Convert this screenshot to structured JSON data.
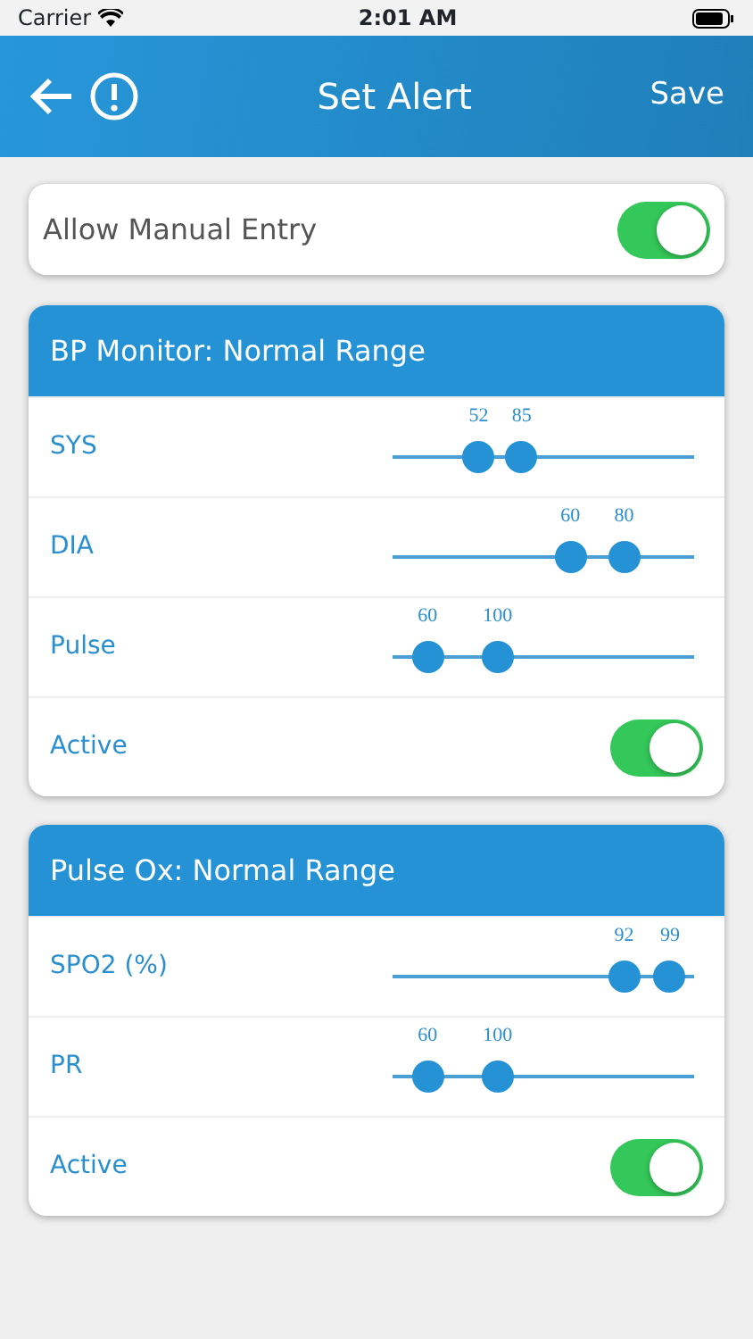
{
  "status_bar": {
    "carrier": "Carrier",
    "time": "2:01 AM"
  },
  "header": {
    "title": "Set Alert",
    "action": "Save"
  },
  "manual_entry": {
    "label": "Allow Manual Entry",
    "on": true
  },
  "cards": [
    {
      "title": "BP Monitor: Normal Range",
      "rows": [
        {
          "kind": "range",
          "label": "SYS",
          "thumbs": [
            {
              "value": "52",
              "level": 0.26
            },
            {
              "value": "85",
              "level": 0.42
            }
          ]
        },
        {
          "kind": "range",
          "label": "DIA",
          "thumbs": [
            {
              "value": "60",
              "level": 0.6
            },
            {
              "value": "80",
              "level": 0.8
            }
          ]
        },
        {
          "kind": "range",
          "label": "Pulse",
          "thumbs": [
            {
              "value": "60",
              "level": 0.07
            },
            {
              "value": "100",
              "level": 0.33
            }
          ]
        },
        {
          "kind": "toggle",
          "label": "Active",
          "on": true
        }
      ]
    },
    {
      "title": "Pulse Ox: Normal Range",
      "rows": [
        {
          "kind": "range",
          "label": "SPO2 (%)",
          "thumbs": [
            {
              "value": "92",
              "level": 0.8
            },
            {
              "value": "99",
              "level": 0.97
            }
          ]
        },
        {
          "kind": "range",
          "label": "PR",
          "thumbs": [
            {
              "value": "60",
              "level": 0.07
            },
            {
              "value": "100",
              "level": 0.33
            }
          ]
        },
        {
          "kind": "toggle",
          "label": "Active",
          "on": true
        }
      ]
    }
  ]
}
